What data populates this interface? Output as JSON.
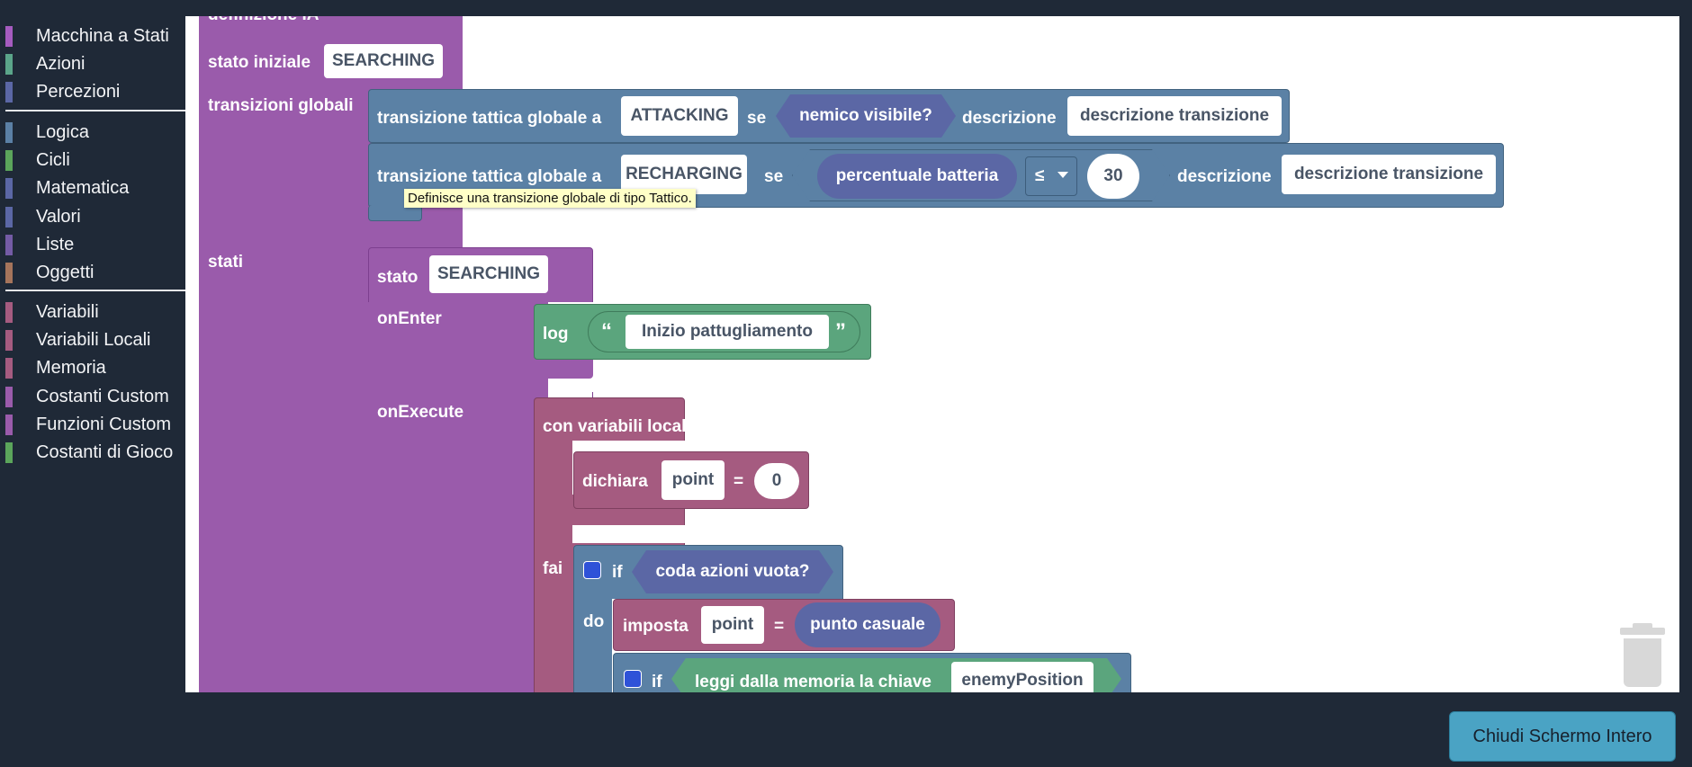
{
  "toolbox": {
    "groups": [
      [
        {
          "label": "Macchina a Stati",
          "color": "#a55bbf"
        },
        {
          "label": "Azioni",
          "color": "#5ba58a"
        },
        {
          "label": "Percezioni",
          "color": "#5b67a5"
        }
      ],
      [
        {
          "label": "Logica",
          "color": "#5b80a5"
        },
        {
          "label": "Cicli",
          "color": "#5ba55b"
        },
        {
          "label": "Matematica",
          "color": "#5b67a5"
        },
        {
          "label": "Valori",
          "color": "#5b67a5"
        },
        {
          "label": "Liste",
          "color": "#745ba5"
        },
        {
          "label": "Oggetti",
          "color": "#a5745b"
        }
      ],
      [
        {
          "label": "Variabili",
          "color": "#a55b80"
        },
        {
          "label": "Variabili Locali",
          "color": "#a55b80"
        },
        {
          "label": "Memoria",
          "color": "#a55b80"
        },
        {
          "label": "Costanti Custom",
          "color": "#9a5bab"
        },
        {
          "label": "Funzioni Custom",
          "color": "#9a5bab"
        },
        {
          "label": "Costanti di Gioco",
          "color": "#5ba55b"
        }
      ]
    ]
  },
  "workspace": {
    "definition_label": "definizione IA",
    "initial_state_label": "stato iniziale",
    "initial_state_value": "SEARCHING",
    "global_transitions_label": "transizioni globali",
    "transition1": {
      "prefix": "transizione tattica globale a",
      "target": "ATTACKING",
      "if": "se",
      "condition": "nemico visibile?",
      "desc_label": "descrizione",
      "desc_value": "descrizione transizione"
    },
    "transition2": {
      "prefix": "transizione tattica globale a",
      "target": "RECHARGING",
      "if": "se",
      "left": "percentuale batteria",
      "operator": "≤",
      "right": "30",
      "desc_label": "descrizione",
      "desc_value": "descrizione transizione"
    },
    "tooltip": "Definisce una transizione globale di tipo Tattico.",
    "states_label": "stati",
    "state": {
      "label": "stato",
      "name": "SEARCHING",
      "on_enter": "onEnter",
      "on_execute": "onExecute",
      "log_label": "log",
      "open_quote": "“",
      "close_quote": "”",
      "log_text": "Inizio pattugliamento",
      "with_locals": "con variabili locali",
      "declare": "dichiara",
      "var_name": "point",
      "equals": "=",
      "init_value": "0",
      "do_label": "fai",
      "if1": "if",
      "if1_condition": "coda azioni vuota?",
      "do1": "do",
      "set_label": "imposta",
      "set_var": "point",
      "set_value": "punto casuale",
      "if2": "if",
      "if2_condition": "leggi dalla memoria la chiave",
      "memory_key": "enemyPosition"
    }
  },
  "footer": {
    "close_fullscreen": "Chiudi Schermo Intero"
  }
}
